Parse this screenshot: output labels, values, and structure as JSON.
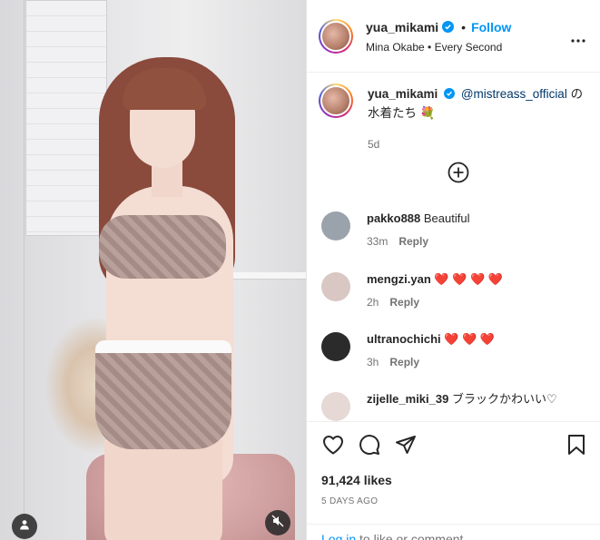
{
  "post": {
    "username": "yua_mikami",
    "follow_label": "Follow",
    "separator": "•",
    "audio": "Mina Okabe • Every Second",
    "caption_mention": "@mistreass_official",
    "caption_text": " の水着たち 💐",
    "caption_time": "5d",
    "likes": "91,424 likes",
    "posted": "5 DAYS AGO",
    "login_link": "Log in",
    "login_suffix": " to like or comment."
  },
  "comments": [
    {
      "username": "pakko888",
      "text": "Beautiful",
      "time": "33m",
      "reply": "Reply",
      "avatar_color": "#9aa3ab"
    },
    {
      "username": "mengzi.yan",
      "text": "❤️ ❤️ ❤️ ❤️",
      "time": "2h",
      "reply": "Reply",
      "avatar_color": "#d8c7c2"
    },
    {
      "username": "ultranochichi",
      "text": "❤️ ❤️ ❤️",
      "time": "3h",
      "reply": "Reply",
      "avatar_color": "#2b2b2b"
    },
    {
      "username": "zijelle_miki_39",
      "text": "ブラックかわいい♡",
      "time": "",
      "reply": "",
      "avatar_color": "#e6d8d4"
    }
  ],
  "colors": {
    "accent": "#0095f6",
    "verified": "#0095f6",
    "mention": "#00376b",
    "muted": "#737373",
    "heart": "#ed4956"
  },
  "icons": {
    "more": "more-horizontal-icon",
    "add": "plus-circle-icon",
    "like": "heart-outline-icon",
    "comment": "comment-bubble-icon",
    "share": "paper-plane-icon",
    "save": "bookmark-icon",
    "user_tag": "user-tag-icon",
    "mute": "speaker-muted-icon"
  }
}
